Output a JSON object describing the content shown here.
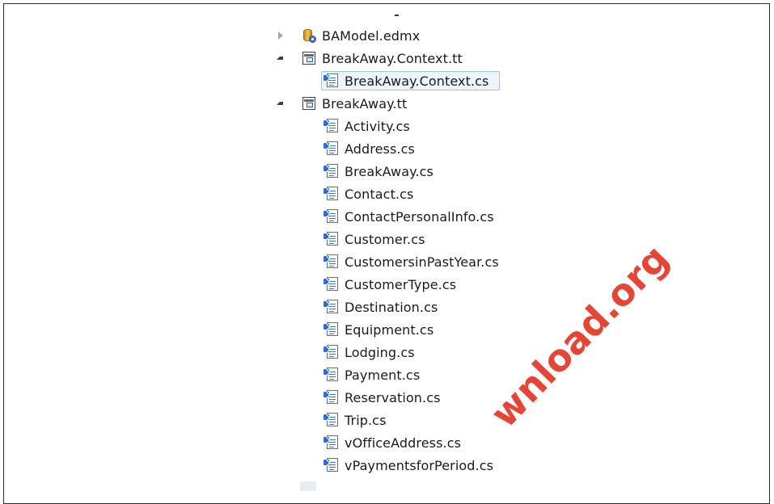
{
  "tree": {
    "items": [
      {
        "label": "BAModel.edmx",
        "icon": "edmx-icon",
        "expander": "collapsed"
      },
      {
        "label": "BreakAway.Context.tt",
        "icon": "tt-template-icon",
        "expander": "expanded"
      },
      {
        "label": "BreakAway.Context.cs",
        "icon": "cs-file-icon",
        "selected": true
      },
      {
        "label": "BreakAway.tt",
        "icon": "tt-template-icon",
        "expander": "expanded"
      },
      {
        "label": "Activity.cs",
        "icon": "cs-file-icon"
      },
      {
        "label": "Address.cs",
        "icon": "cs-file-icon"
      },
      {
        "label": "BreakAway.cs",
        "icon": "cs-file-icon"
      },
      {
        "label": "Contact.cs",
        "icon": "cs-file-icon"
      },
      {
        "label": "ContactPersonalInfo.cs",
        "icon": "cs-file-icon"
      },
      {
        "label": "Customer.cs",
        "icon": "cs-file-icon"
      },
      {
        "label": "CustomersinPastYear.cs",
        "icon": "cs-file-icon"
      },
      {
        "label": "CustomerType.cs",
        "icon": "cs-file-icon"
      },
      {
        "label": "Destination.cs",
        "icon": "cs-file-icon"
      },
      {
        "label": "Equipment.cs",
        "icon": "cs-file-icon"
      },
      {
        "label": "Lodging.cs",
        "icon": "cs-file-icon"
      },
      {
        "label": "Payment.cs",
        "icon": "cs-file-icon"
      },
      {
        "label": "Reservation.cs",
        "icon": "cs-file-icon"
      },
      {
        "label": "Trip.cs",
        "icon": "cs-file-icon"
      },
      {
        "label": "vOfficeAddress.cs",
        "icon": "cs-file-icon"
      },
      {
        "label": "vPaymentsforPeriod.cs",
        "icon": "cs-file-icon"
      }
    ]
  },
  "watermark": {
    "text": "wnload.org",
    "color": "#e3311f"
  },
  "colors": {
    "selection_bg": "#eef4fc",
    "selection_border": "#99c3ee",
    "border": "#2b2b2b"
  }
}
